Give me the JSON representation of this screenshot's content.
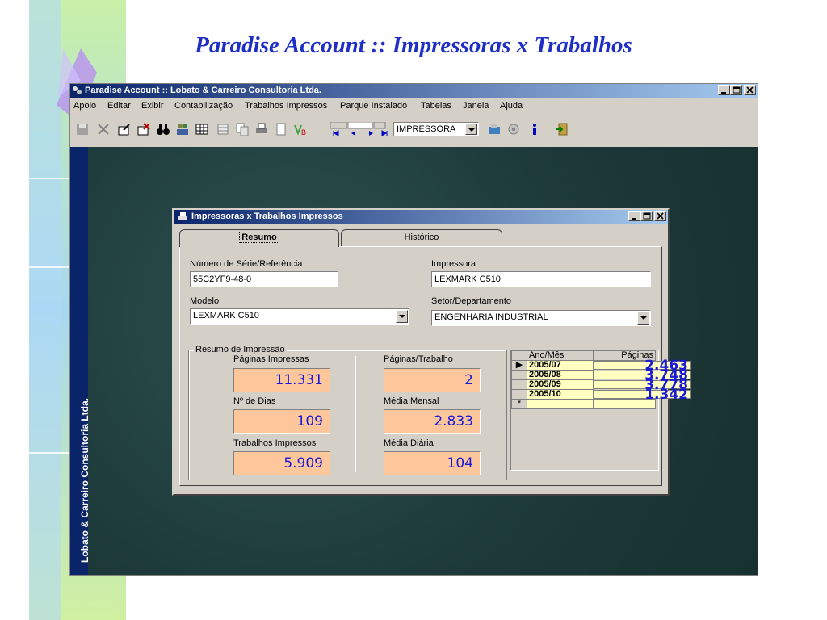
{
  "slide": {
    "title": "Paradise Account :: Impressoras x Trabalhos"
  },
  "app": {
    "title": "Paradise Account :: Lobato & Carreiro Consultoria Ltda.",
    "menu": [
      "Apoio",
      "Editar",
      "Exibir",
      "Contabilização",
      "Trabalhos Impressos",
      "Parque Instalado",
      "Tabelas",
      "Janela",
      "Ajuda"
    ],
    "toolbar_combo_value": "IMPRESSORA",
    "brand_strip_text": "Lobato & Carreiro Consultoria Ltda.",
    "colors": {
      "titlebar": "#0a246a",
      "workspace": "#1c3838",
      "highlight_field": "#fdc79b",
      "value_text": "#1a1ad6"
    }
  },
  "window": {
    "title": "Impressoras x Trabalhos Impressos",
    "tabs": [
      "Resumo",
      "Histórico"
    ],
    "active_tab": "Resumo",
    "fields": {
      "serial_label": "Número de Série/Referência",
      "serial_value": "55C2YF9-48-0",
      "printer_label": "Impressora",
      "printer_value": "LEXMARK C510",
      "model_label": "Modelo",
      "model_value": "LEXMARK C510",
      "sector_label": "Setor/Departamento",
      "sector_value": "ENGENHARIA INDUSTRIAL"
    },
    "summary": {
      "group_label": "Resumo de Impressão",
      "pages_printed_label": "Páginas Impressas",
      "pages_printed": "11.331",
      "days_label": "Nº de Dias",
      "days": "109",
      "jobs_label": "Trabalhos Impressos",
      "jobs": "5.909",
      "pages_per_job_label": "Páginas/Trabalho",
      "pages_per_job": "2",
      "monthly_avg_label": "Média Mensal",
      "monthly_avg": "2.833",
      "daily_avg_label": "Média Diária",
      "daily_avg": "104"
    },
    "grid": {
      "headers": [
        "Ano/Mês",
        "Páginas"
      ],
      "rows": [
        {
          "month": "2005/07",
          "pages": "2.463"
        },
        {
          "month": "2005/08",
          "pages": "3.748"
        },
        {
          "month": "2005/09",
          "pages": "3.778"
        },
        {
          "month": "2005/10",
          "pages": "1.342"
        }
      ],
      "new_row_marker": "*"
    }
  }
}
